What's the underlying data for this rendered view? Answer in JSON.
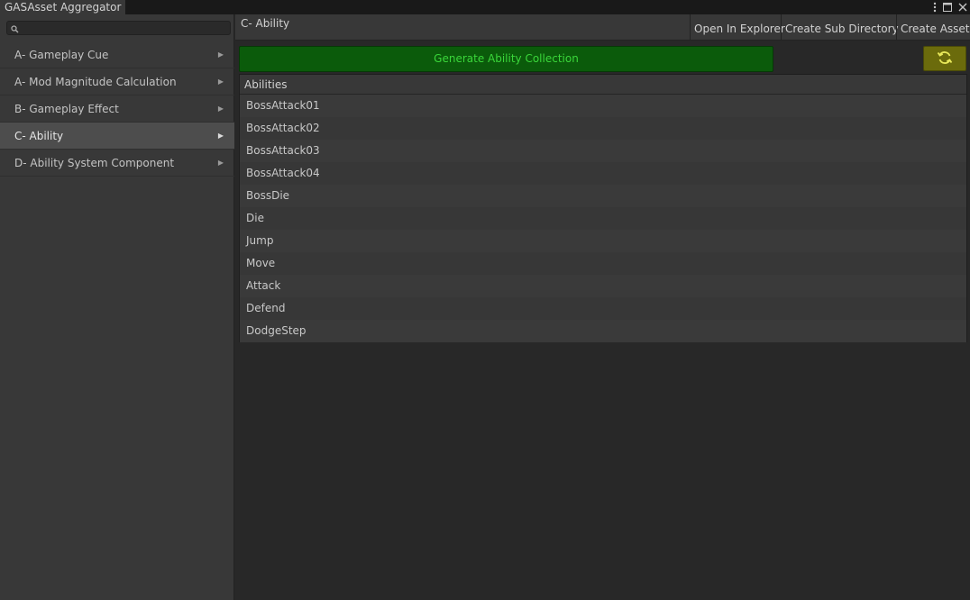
{
  "window": {
    "tab_title": "GASAsset Aggregator",
    "controls": [
      "more-icon",
      "maximize-icon",
      "close-icon"
    ]
  },
  "sidebar": {
    "search": {
      "value": "",
      "placeholder": ""
    },
    "items": [
      {
        "label": "A- Gameplay Cue",
        "active": false
      },
      {
        "label": "A- Mod Magnitude Calculation",
        "active": false
      },
      {
        "label": "B- Gameplay Effect",
        "active": false
      },
      {
        "label": "C- Ability",
        "active": true
      },
      {
        "label": "D- Ability System Component",
        "active": false
      }
    ],
    "arrow": "▶"
  },
  "toolbar": {
    "title": "C- Ability",
    "open_in_explorer": "Open In Explorer",
    "create_sub_directory": "Create Sub Directory",
    "create_asset": "Create Asset"
  },
  "main": {
    "generate_label": "Generate Ability Collection",
    "refresh_icon": "refresh-icon",
    "list": {
      "header": "Abilities",
      "rows": [
        "BossAttack01",
        "BossAttack02",
        "BossAttack03",
        "BossAttack04",
        "BossDie",
        "Die",
        "Jump",
        "Move",
        "Attack",
        "Defend",
        "DodgeStep"
      ]
    }
  },
  "colors": {
    "generate_bg": "#0b5b0b",
    "generate_text": "#3ad63a",
    "refresh_bg": "#6b6b0c",
    "refresh_icon": "#e8e85a",
    "active_item_bg": "#4d4d4d"
  }
}
